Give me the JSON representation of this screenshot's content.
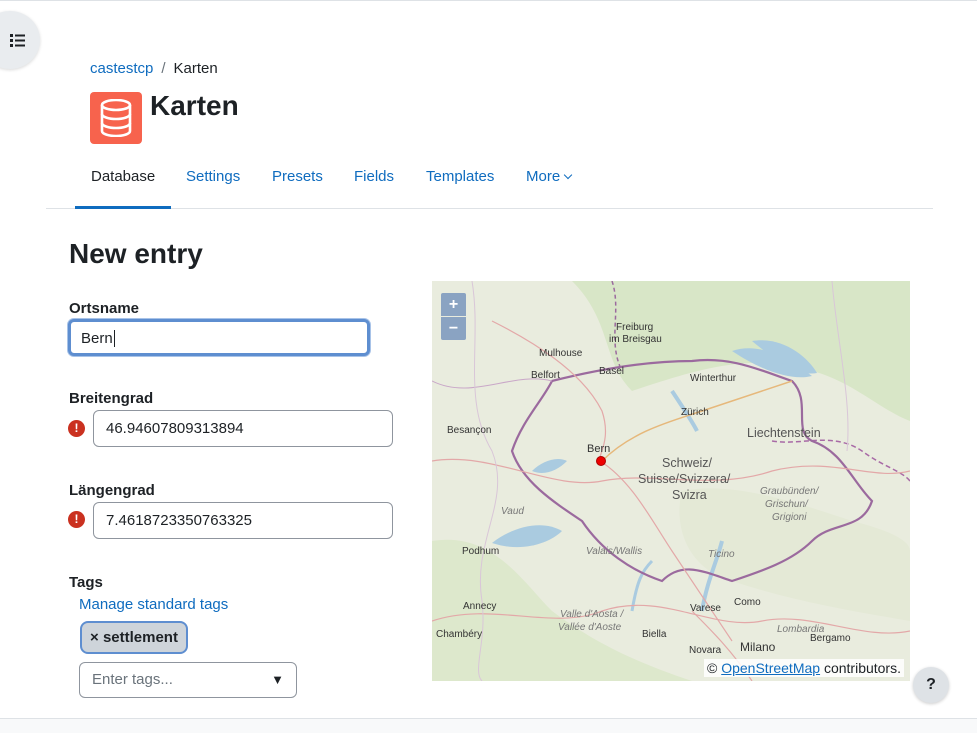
{
  "breadcrumb": {
    "course": "castestcp",
    "separator": "/",
    "current": "Karten"
  },
  "page": {
    "title": "Karten",
    "icon": "database-icon",
    "icon_color": "#f7634d"
  },
  "tabs": [
    {
      "label": "Database",
      "active": true
    },
    {
      "label": "Settings"
    },
    {
      "label": "Presets"
    },
    {
      "label": "Fields"
    },
    {
      "label": "Templates"
    },
    {
      "label": "More"
    }
  ],
  "form": {
    "heading": "New entry",
    "ortsname": {
      "label": "Ortsname",
      "value": "Bern"
    },
    "breitengrad": {
      "label": "Breitengrad",
      "value": "46.94607809313894"
    },
    "laengengrad": {
      "label": "Längengrad",
      "value": "7.4618723350763325"
    },
    "tags": {
      "label": "Tags",
      "manage_link": "Manage standard tags",
      "selected": "settlement",
      "remove_glyph": "×",
      "placeholder": "Enter tags..."
    }
  },
  "map": {
    "zoom_in": "+",
    "zoom_out": "−",
    "marker_label": "Bern",
    "places": {
      "freiburg": "Freiburg",
      "breisgau": "im Breisgau",
      "mulhouse": "Mulhouse",
      "basel": "Basel",
      "belfort": "Belfort",
      "winterthur": "Winterthur",
      "zurich": "Zürich",
      "besancon": "Besançon",
      "liechtenstein": "Liechtenstein",
      "schweiz1": "Schweiz/",
      "schweiz2": "Suisse/Svizzera/",
      "schweiz3": "Svizra",
      "graubuenden1": "Graubünden/",
      "graubuenden2": "Grischun/",
      "graubuenden3": "Grigioni",
      "vaud": "Vaud",
      "valais": "Valais/Wallis",
      "ticino": "Ticino",
      "podhum": "Podhum",
      "annecy": "Annecy",
      "aosta1": "Valle d'Aosta /",
      "aosta2": "Vallée d'Aoste",
      "varese": "Varese",
      "como": "Como",
      "lombardia": "Lombardia",
      "chambery": "Chambéry",
      "biella": "Biella",
      "novara": "Novara",
      "milano": "Milano",
      "bergamo": "Bergamo"
    },
    "attribution_prefix": "©",
    "attribution_link": "OpenStreetMap",
    "attribution_suffix": "contributors."
  },
  "help": {
    "label": "?"
  },
  "colors": {
    "link": "#0f6cbf",
    "error": "#ca3120",
    "focus": "#5e8ed0"
  }
}
